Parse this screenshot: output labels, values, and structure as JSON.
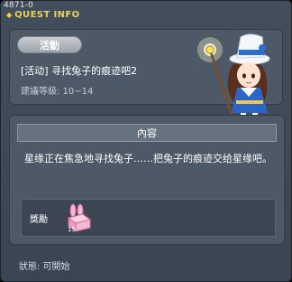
{
  "header": {
    "quest_id": "4871-0",
    "title": "QUEST INFO"
  },
  "info": {
    "tag": "活動",
    "quest_title": "[活动] 寻找兔子的痕迹吧2",
    "level_req": "建議等級: 10~14"
  },
  "content": {
    "header": "內容",
    "description": "星缘正在焦急地寻找兔子……把兔子的痕迹交给星缘吧。"
  },
  "reward": {
    "label": "獎勵",
    "item_icon": "pink-rabbit-box-icon",
    "item_count": "15"
  },
  "status": "狀態: 可開始",
  "colors": {
    "window_bg": "#3e4957",
    "panel_bg": "#4d5967",
    "title_gold": "#ecd05a",
    "tag_pill": "#aeb4bc"
  }
}
